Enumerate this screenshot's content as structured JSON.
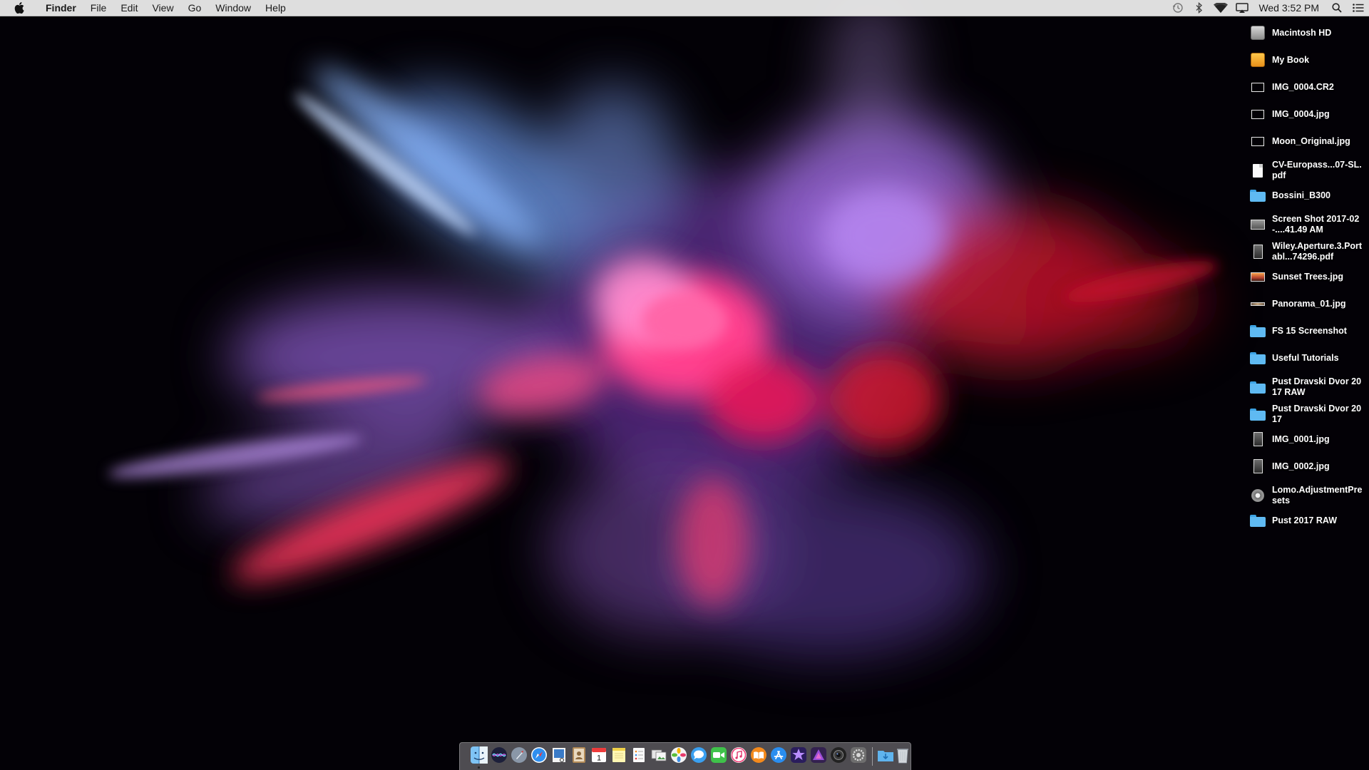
{
  "menubar": {
    "apple_icon": "apple-logo",
    "app_name": "Finder",
    "menus": [
      "File",
      "Edit",
      "View",
      "Go",
      "Window",
      "Help"
    ],
    "status_icons": [
      "time-machine-icon",
      "bluetooth-icon",
      "wifi-icon",
      "airplay-icon"
    ],
    "clock": "Wed 3:52 PM",
    "spotlight_icon": "search-icon",
    "notifications_icon": "list-icon"
  },
  "desktop_items": [
    {
      "label": "Macintosh HD",
      "icon": "hard-disk"
    },
    {
      "label": "My Book",
      "icon": "external-disk"
    },
    {
      "label": "IMG_0004.CR2",
      "icon": "raw-image"
    },
    {
      "label": "IMG_0004.jpg",
      "icon": "image"
    },
    {
      "label": "Moon_Original.jpg",
      "icon": "image"
    },
    {
      "label": "CV-Europass...07-SL.pdf",
      "icon": "pdf"
    },
    {
      "label": "Bossini_B300",
      "icon": "folder"
    },
    {
      "label": "Screen Shot 2017-02-....41.49 AM",
      "icon": "screenshot"
    },
    {
      "label": "Wiley.Aperture.3.Portabl...74296.pdf",
      "icon": "pdf-book"
    },
    {
      "label": "Sunset Trees.jpg",
      "icon": "image-sunset"
    },
    {
      "label": "Panorama_01.jpg",
      "icon": "image-panorama"
    },
    {
      "label": "FS 15 Screenshot",
      "icon": "folder"
    },
    {
      "label": "Useful Tutorials",
      "icon": "folder"
    },
    {
      "label": "Pust Dravski Dvor 2017 RAW",
      "icon": "folder"
    },
    {
      "label": "Pust Dravski Dvor 2017",
      "icon": "folder"
    },
    {
      "label": "IMG_0001.jpg",
      "icon": "image-portrait"
    },
    {
      "label": "IMG_0002.jpg",
      "icon": "image-portrait"
    },
    {
      "label": "Lomo.AdjustmentPresets",
      "icon": "preset"
    },
    {
      "label": "Pust 2017 RAW",
      "icon": "folder"
    }
  ],
  "dock": {
    "apps": [
      "finder",
      "siri",
      "launchpad",
      "safari",
      "preview",
      "contacts",
      "calendar",
      "notes",
      "reminders",
      "photos-browser",
      "photos",
      "messages",
      "facetime",
      "itunes",
      "ibooks",
      "app-store",
      "imovie",
      "affinity-photo",
      "camera-app",
      "system-preferences"
    ],
    "calendar_day": "1",
    "stacks": [
      "downloads",
      "trash"
    ]
  }
}
